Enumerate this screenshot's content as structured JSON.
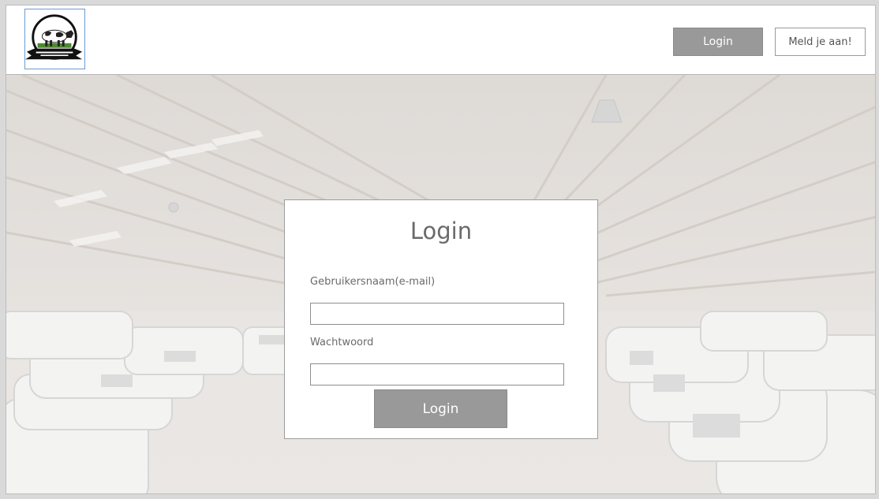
{
  "header": {
    "logo_icon": "cow-logo-icon",
    "login_label": "Login",
    "register_label": "Meld je aan!"
  },
  "login_panel": {
    "title": "Login",
    "username_label": "Gebruikersnaam(e-mail)",
    "username_value": "",
    "password_label": "Wachtwoord",
    "password_value": "",
    "submit_label": "Login"
  },
  "background": {
    "image": "caravan-storage-hall-photo",
    "accent": "#999999"
  }
}
